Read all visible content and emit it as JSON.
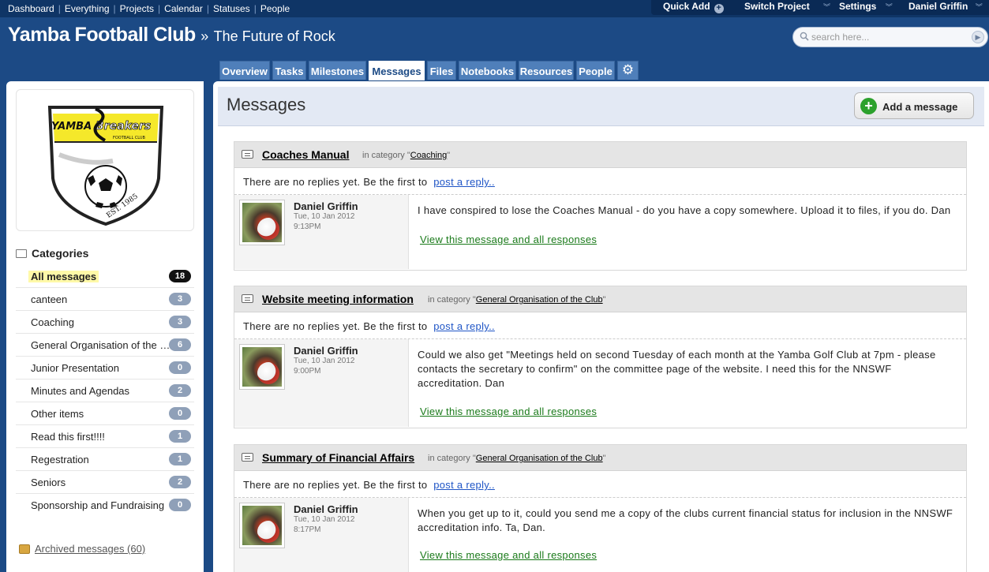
{
  "topnav": {
    "links": [
      "Dashboard",
      "Everything",
      "Projects",
      "Calendar",
      "Statuses",
      "People"
    ],
    "quick_add": "Quick Add",
    "switch_project": "Switch Project",
    "settings": "Settings",
    "user": "Daniel Griffin"
  },
  "header": {
    "project": "Yamba Football Club",
    "separator": "»",
    "subtitle": "The Future of Rock",
    "search_placeholder": "search here..."
  },
  "tabs": [
    {
      "label": "Overview"
    },
    {
      "label": "Tasks"
    },
    {
      "label": "Milestones"
    },
    {
      "label": "Messages",
      "active": true
    },
    {
      "label": "Files"
    },
    {
      "label": "Notebooks"
    },
    {
      "label": "Resources"
    },
    {
      "label": "People"
    },
    {
      "label": "⚙",
      "icon": "gear-icon"
    }
  ],
  "sidebar": {
    "logo": {
      "brand_left": "YAMBA",
      "brand_right": "Breakers",
      "club": "FOOTBALL CLUB",
      "est": "EST. 1985"
    },
    "categories_title": "Categories",
    "categories": [
      {
        "label": "All messages",
        "count": "18",
        "selected": true
      },
      {
        "label": "canteen",
        "count": "3"
      },
      {
        "label": "Coaching",
        "count": "3"
      },
      {
        "label": "General Organisation of the Club",
        "count": "6"
      },
      {
        "label": "Junior Presentation",
        "count": "0"
      },
      {
        "label": "Minutes and Agendas",
        "count": "2"
      },
      {
        "label": "Other items",
        "count": "0"
      },
      {
        "label": "Read this first!!!!",
        "count": "1"
      },
      {
        "label": "Regestration",
        "count": "1"
      },
      {
        "label": "Seniors",
        "count": "2"
      },
      {
        "label": "Sponsorship and Fundraising",
        "count": "0"
      }
    ],
    "archived": "Archived messages (60)"
  },
  "main": {
    "title": "Messages",
    "add_button": "Add a message",
    "no_replies_text": "There are no replies yet. Be the first to",
    "reply_link": "post a reply..",
    "in_category": "in category",
    "view_link": "View this message and all responses",
    "messages": [
      {
        "title": "Coaches Manual",
        "category": "Coaching",
        "author": "Daniel Griffin",
        "date": "Tue, 10 Jan 2012",
        "time": "9:13PM",
        "body": "I have conspired to lose the Coaches Manual - do you have a copy somewhere. Upload it to files, if you do. Dan"
      },
      {
        "title": "Website meeting information",
        "category": "General Organisation of the Club",
        "author": "Daniel Griffin",
        "date": "Tue, 10 Jan 2012",
        "time": "9:00PM",
        "body": "Could we also get \"Meetings held on second Tuesday of each month at the Yamba Golf Club at 7pm - please contacts the secretary to confirm\" on the committee page of the website. I need this for the NNSWF accreditation. Dan"
      },
      {
        "title": "Summary of Financial Affairs",
        "category": "General Organisation of the Club",
        "author": "Daniel Griffin",
        "date": "Tue, 10 Jan 2012",
        "time": "8:17PM",
        "body": "When you get up to it, could you send me a copy of the clubs current financial status for inclusion in the NNSWF accreditation info. Ta, Dan."
      }
    ]
  }
}
